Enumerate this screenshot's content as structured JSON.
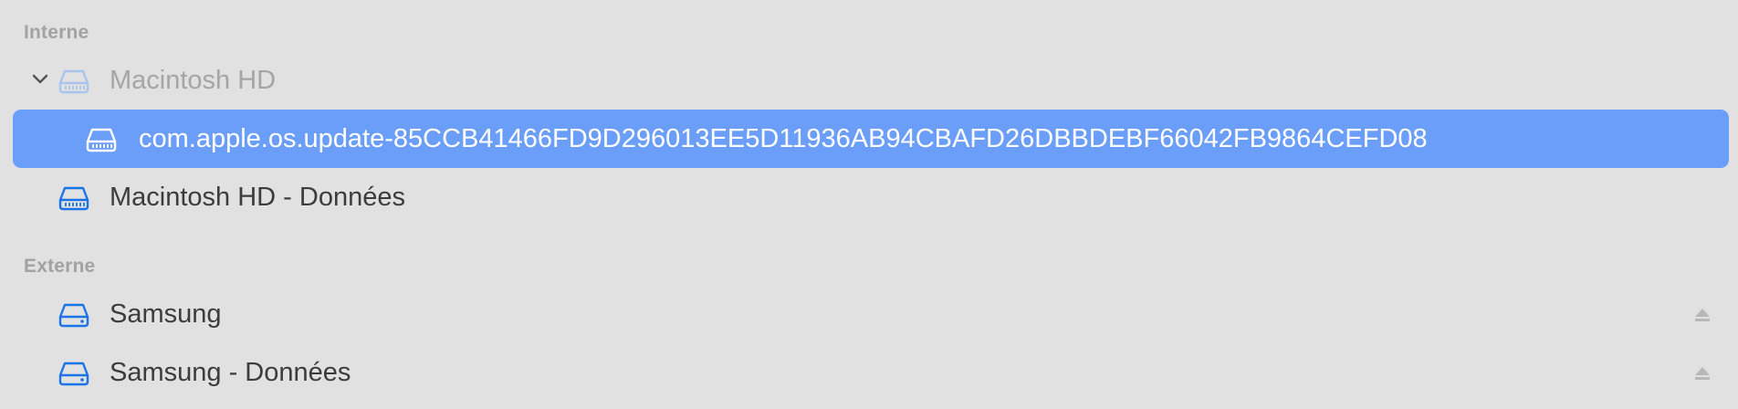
{
  "sidebar": {
    "internal_header": "Interne",
    "external_header": "Externe",
    "items": [
      {
        "label": "Macintosh HD",
        "icon": "internal-drive-icon"
      },
      {
        "label": "com.apple.os.update-85CCB41466FD9D296013EE5D11936AB94CBAFD26DBBDEBF66042FB9864CEFD08",
        "icon": "internal-drive-icon"
      },
      {
        "label": "Macintosh HD - Données",
        "icon": "internal-drive-icon"
      },
      {
        "label": "Samsung",
        "icon": "external-drive-icon"
      },
      {
        "label": "Samsung - Données",
        "icon": "external-drive-icon"
      }
    ]
  },
  "colors": {
    "accent": "#1a73e8",
    "selection": "#6b9ef8",
    "background": "#e0e1e0",
    "section_header": "#a2a2a2"
  }
}
